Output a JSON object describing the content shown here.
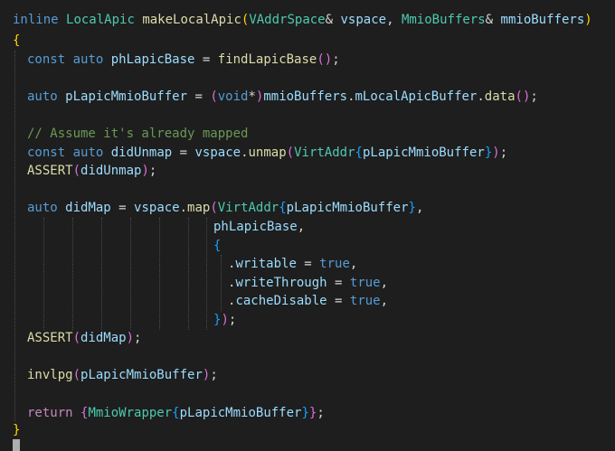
{
  "editor": {
    "lines": [
      {
        "id": 1,
        "tokens": [
          [
            "k",
            "inline"
          ],
          [
            "p",
            " "
          ],
          [
            "t",
            "LocalApic"
          ],
          [
            "p",
            " "
          ],
          [
            "f",
            "makeLocalApic"
          ],
          [
            "b",
            "("
          ],
          [
            "t",
            "VAddrSpace"
          ],
          [
            "p",
            "&"
          ],
          [
            "p",
            " "
          ],
          [
            "v",
            "vspace"
          ],
          [
            "p",
            ", "
          ],
          [
            "t",
            "MmioBuffers"
          ],
          [
            "p",
            "&"
          ],
          [
            "p",
            " "
          ],
          [
            "v",
            "mmioBuffers"
          ],
          [
            "b",
            ")"
          ]
        ]
      },
      {
        "id": 2,
        "tokens": [
          [
            "b",
            "{"
          ]
        ]
      },
      {
        "id": 3,
        "tokens": [
          [
            "k",
            "const"
          ],
          [
            "p",
            " "
          ],
          [
            "k",
            "auto"
          ],
          [
            "p",
            " "
          ],
          [
            "v",
            "phLapicBase"
          ],
          [
            "p",
            " = "
          ],
          [
            "f",
            "findLapicBase"
          ],
          [
            "bb",
            "()"
          ],
          [
            "p",
            ";"
          ]
        ]
      },
      {
        "id": 4,
        "tokens": []
      },
      {
        "id": 5,
        "tokens": [
          [
            "k",
            "auto"
          ],
          [
            "p",
            " "
          ],
          [
            "v",
            "pLapicMmioBuffer"
          ],
          [
            "p",
            " = "
          ],
          [
            "bb",
            "("
          ],
          [
            "k",
            "void"
          ],
          [
            "p",
            "*"
          ],
          [
            "bb",
            ")"
          ],
          [
            "v",
            "mmioBuffers"
          ],
          [
            "p",
            "."
          ],
          [
            "v",
            "mLocalApicBuffer"
          ],
          [
            "p",
            "."
          ],
          [
            "f",
            "data"
          ],
          [
            "bb",
            "()"
          ],
          [
            "p",
            ";"
          ]
        ]
      },
      {
        "id": 6,
        "tokens": []
      },
      {
        "id": 7,
        "tokens": [
          [
            "c",
            "// Assume it's already mapped"
          ]
        ]
      },
      {
        "id": 8,
        "tokens": [
          [
            "k",
            "const"
          ],
          [
            "p",
            " "
          ],
          [
            "k",
            "auto"
          ],
          [
            "p",
            " "
          ],
          [
            "v",
            "didUnmap"
          ],
          [
            "p",
            " = "
          ],
          [
            "v",
            "vspace"
          ],
          [
            "p",
            "."
          ],
          [
            "f",
            "unmap"
          ],
          [
            "bb",
            "("
          ],
          [
            "t",
            "VirtAddr"
          ],
          [
            "bc",
            "{"
          ],
          [
            "v",
            "pLapicMmioBuffer"
          ],
          [
            "bc",
            "}"
          ],
          [
            "bb",
            ")"
          ],
          [
            "p",
            ";"
          ]
        ]
      },
      {
        "id": 9,
        "tokens": [
          [
            "f",
            "ASSERT"
          ],
          [
            "bb",
            "("
          ],
          [
            "v",
            "didUnmap"
          ],
          [
            "bb",
            ")"
          ],
          [
            "p",
            ";"
          ]
        ]
      },
      {
        "id": 10,
        "tokens": []
      },
      {
        "id": 11,
        "tokens": [
          [
            "k",
            "auto"
          ],
          [
            "p",
            " "
          ],
          [
            "v",
            "didMap"
          ],
          [
            "p",
            " = "
          ],
          [
            "v",
            "vspace"
          ],
          [
            "p",
            "."
          ],
          [
            "f",
            "map"
          ],
          [
            "bb",
            "("
          ],
          [
            "t",
            "VirtAddr"
          ],
          [
            "bc",
            "{"
          ],
          [
            "v",
            "pLapicMmioBuffer"
          ],
          [
            "bc",
            "}"
          ],
          [
            "p",
            ","
          ]
        ]
      },
      {
        "id": 12,
        "tokens": [
          [
            "v",
            "phLapicBase"
          ],
          [
            "p",
            ","
          ]
        ]
      },
      {
        "id": 13,
        "tokens": [
          [
            "bc",
            "{"
          ]
        ]
      },
      {
        "id": 14,
        "tokens": [
          [
            "p",
            "."
          ],
          [
            "v",
            "writable"
          ],
          [
            "p",
            " = "
          ],
          [
            "k",
            "true"
          ],
          [
            "p",
            ","
          ]
        ]
      },
      {
        "id": 15,
        "tokens": [
          [
            "p",
            "."
          ],
          [
            "v",
            "writeThrough"
          ],
          [
            "p",
            " = "
          ],
          [
            "k",
            "true"
          ],
          [
            "p",
            ","
          ]
        ]
      },
      {
        "id": 16,
        "tokens": [
          [
            "p",
            "."
          ],
          [
            "v",
            "cacheDisable"
          ],
          [
            "p",
            " = "
          ],
          [
            "k",
            "true"
          ],
          [
            "p",
            ","
          ]
        ]
      },
      {
        "id": 17,
        "tokens": [
          [
            "bc",
            "}"
          ],
          [
            "bb",
            ")"
          ],
          [
            "p",
            ";"
          ]
        ]
      },
      {
        "id": 18,
        "tokens": [
          [
            "f",
            "ASSERT"
          ],
          [
            "bb",
            "("
          ],
          [
            "v",
            "didMap"
          ],
          [
            "bb",
            ")"
          ],
          [
            "p",
            ";"
          ]
        ]
      },
      {
        "id": 19,
        "tokens": []
      },
      {
        "id": 20,
        "tokens": [
          [
            "f",
            "invlpg"
          ],
          [
            "bb",
            "("
          ],
          [
            "v",
            "pLapicMmioBuffer"
          ],
          [
            "bb",
            ")"
          ],
          [
            "p",
            ";"
          ]
        ]
      },
      {
        "id": 21,
        "tokens": []
      },
      {
        "id": 22,
        "tokens": [
          [
            "m",
            "return"
          ],
          [
            "p",
            " "
          ],
          [
            "bb",
            "{"
          ],
          [
            "t",
            "MmioWrapper"
          ],
          [
            "bc",
            "{"
          ],
          [
            "v",
            "pLapicMmioBuffer"
          ],
          [
            "bc",
            "}"
          ],
          [
            "bb",
            "}"
          ],
          [
            "p",
            ";"
          ]
        ]
      },
      {
        "id": 23,
        "tokens": [
          [
            "b",
            "}"
          ]
        ]
      }
    ]
  }
}
